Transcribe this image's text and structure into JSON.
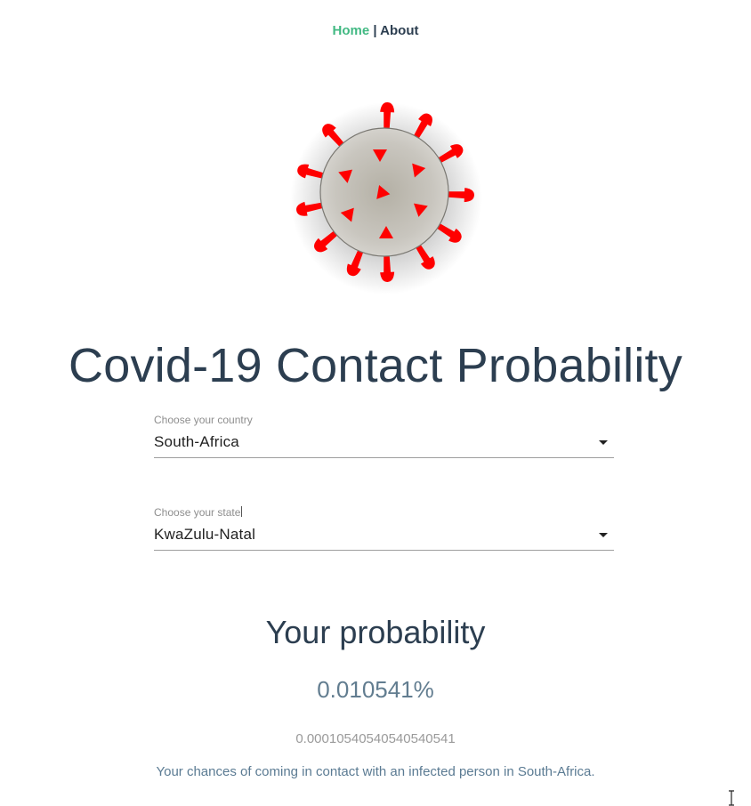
{
  "nav": {
    "home_label": "Home",
    "separator": "|",
    "about_label": "About"
  },
  "logo": {
    "icon": "virus-icon",
    "colors": {
      "body": "#bdbab2",
      "spikes": "#ff0000"
    }
  },
  "page": {
    "title": "Covid-19 Contact Probability"
  },
  "country_select": {
    "label": "Choose your country",
    "value": "South-Africa"
  },
  "state_select": {
    "label": "Choose your state",
    "value": "KwaZulu-Natal"
  },
  "result": {
    "heading": "Your probability",
    "percent": "0.010541%",
    "raw": "0.00010540540540540541",
    "description": "Your chances of coming in contact with an infected person in South-Africa."
  },
  "colors": {
    "accent": "#42b983",
    "text": "#2c3e50"
  }
}
